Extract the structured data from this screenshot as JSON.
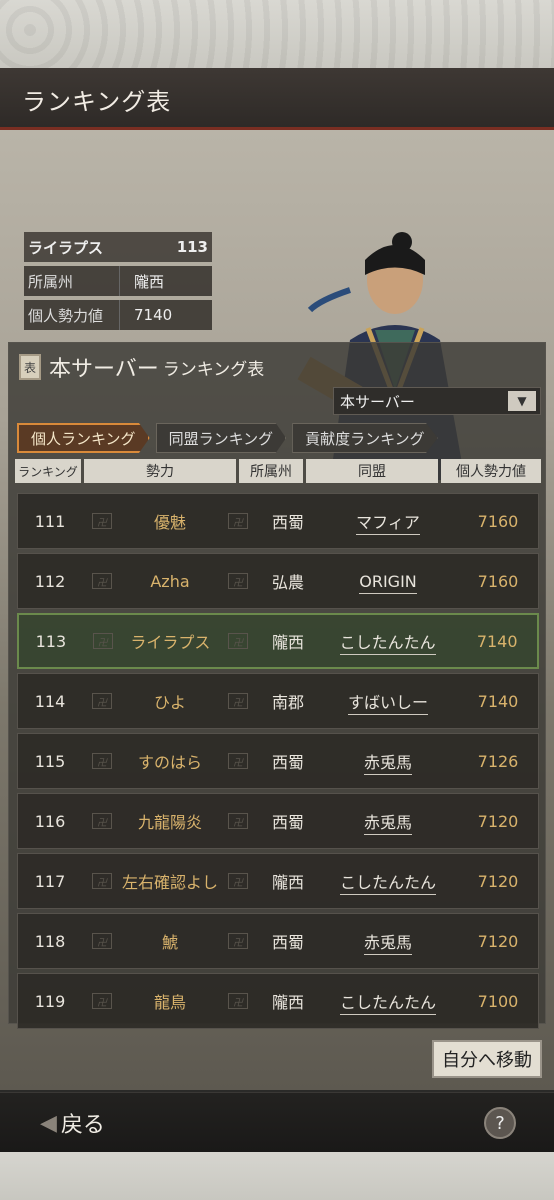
{
  "header": {
    "title": "ランキング表"
  },
  "profile": {
    "name": "ライラプス",
    "rank": "113",
    "province_label": "所属州",
    "province_value": "隴西",
    "power_label": "個人勢力値",
    "power_value": "7140"
  },
  "panel": {
    "title_big": "本サーバー",
    "title_small": "ランキング表",
    "icon_text": "表",
    "dropdown_value": "本サーバー"
  },
  "tabs": [
    {
      "label": "個人ランキング",
      "active": true
    },
    {
      "label": "同盟ランキング",
      "active": false
    },
    {
      "label": "貢献度ランキング",
      "active": false
    }
  ],
  "columns": [
    "ランキング",
    "勢力",
    "所属州",
    "同盟",
    "個人勢力値"
  ],
  "rows": [
    {
      "rank": "111",
      "name": "優魅",
      "province": "西蜀",
      "alliance": "マフィア",
      "power": "7160"
    },
    {
      "rank": "112",
      "name": "Azha",
      "province": "弘農",
      "alliance": "ORIGIN",
      "power": "7160"
    },
    {
      "rank": "113",
      "name": "ライラプス",
      "province": "隴西",
      "alliance": "こしたんたん",
      "power": "7140"
    },
    {
      "rank": "114",
      "name": "ひよ",
      "province": "南郡",
      "alliance": "すばいしー",
      "power": "7140"
    },
    {
      "rank": "115",
      "name": "すのはら",
      "province": "西蜀",
      "alliance": "赤兎馬",
      "power": "7126"
    },
    {
      "rank": "116",
      "name": "九龍陽炎",
      "province": "西蜀",
      "alliance": "赤兎馬",
      "power": "7120"
    },
    {
      "rank": "117",
      "name": "左右確認よし",
      "province": "隴西",
      "alliance": "こしたんたん",
      "power": "7120"
    },
    {
      "rank": "118",
      "name": "鯱",
      "province": "西蜀",
      "alliance": "赤兎馬",
      "power": "7120"
    },
    {
      "rank": "119",
      "name": "龍鳥",
      "province": "隴西",
      "alliance": "こしたんたん",
      "power": "7100"
    }
  ],
  "actions": {
    "move_label": "自分へ移動",
    "back_label": "戻る",
    "help_label": "?"
  },
  "colors": {
    "accent": "#d98a3a",
    "highlight_row": "#6b8a4c"
  }
}
